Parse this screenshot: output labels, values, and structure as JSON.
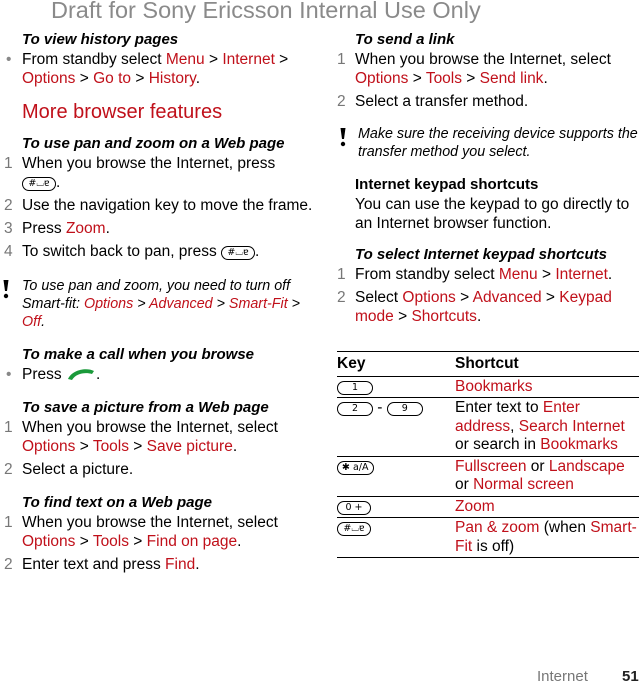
{
  "header": {
    "draft_banner": "Draft for Sony Ericsson Internal Use Only"
  },
  "left": {
    "history": {
      "title": "To view history pages",
      "bullet": [
        "From standby select ",
        "Menu",
        " > ",
        "Internet",
        " > ",
        "Options",
        " > ",
        "Go to",
        " > ",
        "History",
        "."
      ]
    },
    "section_title": "More browser features",
    "panzoom": {
      "title": "To use pan and zoom on a Web page",
      "steps": [
        {
          "num": "1",
          "text": "When you browse the Internet, press",
          "key": "#⌴ɐ"
        },
        {
          "num": "2",
          "text": "Use the navigation key to move the frame."
        },
        {
          "num": "3",
          "pre": "Press ",
          "link": "Zoom",
          "post": "."
        },
        {
          "num": "4",
          "text": "To switch back to pan, press",
          "key": "#⌴ɐ"
        }
      ],
      "note": [
        "To use pan and zoom, you need to turn off Smart-fit: ",
        "Options",
        " > ",
        "Advanced",
        " > ",
        "Smart-Fit",
        " > ",
        "Off",
        "."
      ]
    },
    "call": {
      "title": "To make a call when you browse",
      "bullet_pre": "Press",
      "bullet_post": ".",
      "icon": "call-key-icon"
    },
    "save_picture": {
      "title": "To save a picture from a Web page",
      "step1": [
        "When you browse the Internet, select ",
        "Options",
        " > ",
        "Tools",
        " > ",
        "Save picture",
        "."
      ],
      "step2": "Select a picture."
    },
    "find_text": {
      "title": "To find text on a Web page",
      "step1": [
        "When you browse the Internet, select ",
        "Options",
        " > ",
        "Tools",
        " > ",
        "Find on page",
        "."
      ],
      "step2_pre": "Enter text and press ",
      "step2_link": "Find",
      "step2_post": "."
    }
  },
  "right": {
    "send_link": {
      "title": "To send a link",
      "step1": [
        "When you browse the Internet, select ",
        "Options",
        " > ",
        "Tools",
        " > ",
        "Send link",
        "."
      ],
      "step2": "Select a transfer method.",
      "note": "Make sure the receiving device supports the transfer method you select."
    },
    "keypad": {
      "title": "Internet keypad shortcuts",
      "intro": "You can use the keypad to go directly to an Internet browser function.",
      "select_title": "To select Internet keypad shortcuts",
      "step1": [
        "From standby select ",
        "Menu",
        " > ",
        "Internet",
        "."
      ],
      "step2": [
        "Select ",
        "Options",
        " > ",
        "Advanced",
        " > ",
        "Keypad mode",
        " > ",
        "Shortcuts",
        "."
      ]
    },
    "table": {
      "headers": [
        "Key",
        "Shortcut"
      ],
      "rows": [
        {
          "keys": [
            "1"
          ],
          "parts": [
            [
              "Bookmarks",
              true
            ]
          ]
        },
        {
          "keys": [
            "2",
            "9"
          ],
          "sep": "-",
          "parts": [
            [
              "Enter text to ",
              false
            ],
            [
              "Enter address",
              true
            ],
            [
              ", ",
              false
            ],
            [
              "Search Internet",
              true
            ],
            [
              " or search in ",
              false
            ],
            [
              "Bookmarks",
              true
            ]
          ]
        },
        {
          "keys": [
            "✱ a/A"
          ],
          "parts": [
            [
              "Fullscreen",
              true
            ],
            [
              " or ",
              false
            ],
            [
              "Landscape",
              true
            ],
            [
              " or ",
              false
            ],
            [
              "Normal screen",
              true
            ]
          ]
        },
        {
          "keys": [
            "0 +"
          ],
          "parts": [
            [
              "Zoom",
              true
            ]
          ]
        },
        {
          "keys": [
            "#⌴ɐ"
          ],
          "parts": [
            [
              "Pan & zoom",
              true
            ],
            [
              " (when ",
              false
            ],
            [
              "Smart-Fit",
              true
            ],
            [
              " is off)",
              false
            ]
          ]
        }
      ]
    }
  },
  "footer": {
    "section": "Internet",
    "page": "51"
  },
  "colors": {
    "accent": "#c0101a",
    "call_key": "#1a9a3a"
  }
}
